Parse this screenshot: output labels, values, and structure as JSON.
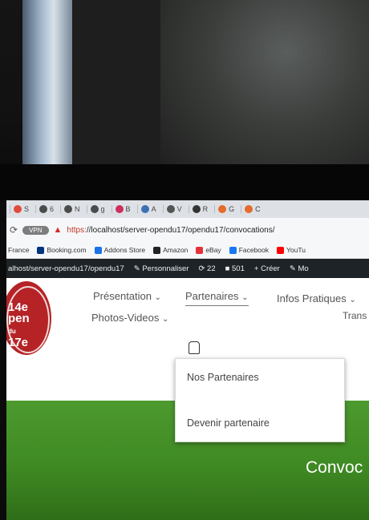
{
  "browser": {
    "tabs": [
      "S",
      "6",
      "N",
      "g",
      "B",
      "A",
      "V",
      "R",
      "G",
      "C"
    ],
    "tab_icon_colors": [
      "#e04b3b",
      "#4b4b4b",
      "#4b4b4b",
      "#4b4b4b",
      "#cc2f5e",
      "#3b70b5",
      "#555555",
      "#333333",
      "#e46b2c",
      "#e46b2c"
    ],
    "vpn_label": "VPN",
    "url_protocol": "https:",
    "url_rest": "//localhost/server-opendu17/opendu17/convocations/",
    "bookmarks": [
      {
        "label": "France",
        "icon": "flag-icon",
        "color": "#2a5db0"
      },
      {
        "label": "Booking.com",
        "icon": "booking-icon",
        "color": "#003580"
      },
      {
        "label": "Addons Store",
        "icon": "addons-icon",
        "color": "#1a73e8"
      },
      {
        "label": "Amazon",
        "icon": "amazon-icon",
        "color": "#222222"
      },
      {
        "label": "eBay",
        "icon": "ebay-icon",
        "color": "#e53238"
      },
      {
        "label": "Facebook",
        "icon": "facebook-icon",
        "color": "#1877f2"
      },
      {
        "label": "YouTu",
        "icon": "youtube-icon",
        "color": "#ff0000"
      }
    ]
  },
  "adminbar": {
    "site_path": "alhost/server-opendu17/opendu17",
    "customize": "Personnaliser",
    "updates": "22",
    "comments": "501",
    "new": "Créer",
    "edit": "Mo"
  },
  "site": {
    "logo_text": "14e",
    "logo_word": "pen",
    "logo_sub": "du",
    "logo_year": "17e",
    "nav": {
      "presentation": "Présentation",
      "partenaires": "Partenaires",
      "infos": "Infos Pratiques",
      "photos": "Photos-Videos",
      "trans": "Trans"
    },
    "submenu": [
      "Nos Partenaires",
      "Devenir partenaire"
    ],
    "hero_title": "Convoc"
  }
}
